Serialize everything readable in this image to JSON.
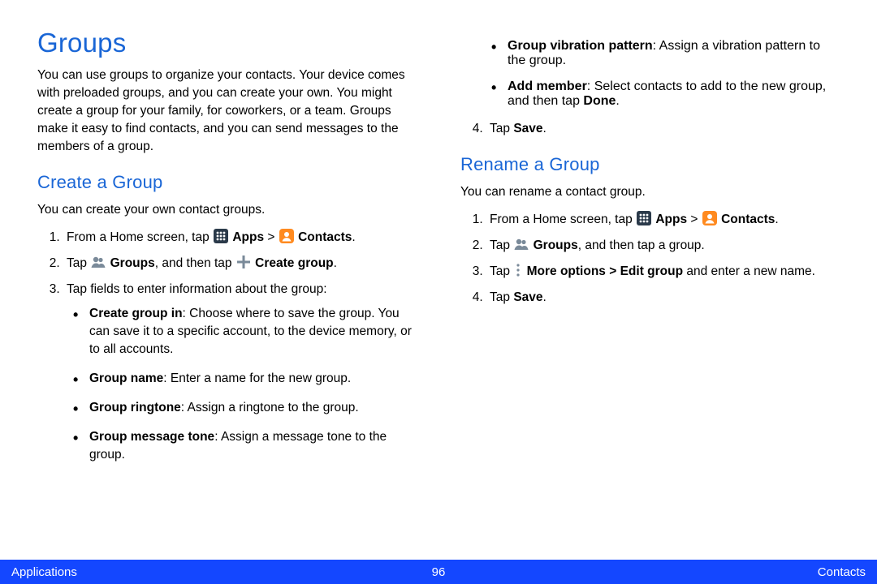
{
  "title": "Groups",
  "intro": "You can use groups to organize your contacts. Your device comes with preloaded groups, and you can create your own. You might create a group for your family, for coworkers, or a team. Groups make it easy to find contacts, and you can send messages to the members of a group.",
  "create": {
    "heading": "Create a Group",
    "sub": "You can create your own contact groups.",
    "step1_a": "From a Home screen, tap ",
    "step1_apps": "Apps",
    "step1_gt": " > ",
    "step1_contacts": "Contacts",
    "step1_end": ".",
    "step2_a": "Tap ",
    "step2_groups": "Groups",
    "step2_b": ", and then tap ",
    "step2_create": "Create group",
    "step2_end": ".",
    "step3": "Tap fields to enter information about the group:",
    "bullets": {
      "b1_label": "Create group in",
      "b1_text": ": Choose where to save the group. You can save it to a specific account, to the device memory, or to all accounts.",
      "b2_label": "Group name",
      "b2_text": ": Enter a name for the new group.",
      "b3_label": "Group ringtone",
      "b3_text": ": Assign a ringtone to the group.",
      "b4_label": "Group message tone",
      "b4_text": ": Assign a message tone to the group.",
      "b5_label": "Group vibration pattern",
      "b5_text": ": Assign a vibration pattern to the group.",
      "b6_label": "Add member",
      "b6_text": ": Select contacts to add to the new group, and then tap ",
      "b6_done": "Done",
      "b6_end": "."
    },
    "step4_a": "Tap ",
    "step4_save": "Save",
    "step4_end": "."
  },
  "rename": {
    "heading": "Rename a Group",
    "sub": "You can rename a contact group.",
    "step1_a": "From a Home screen, tap ",
    "step1_apps": "Apps",
    "step1_gt": " > ",
    "step1_contacts": "Contacts",
    "step1_end": ".",
    "step2_a": "Tap ",
    "step2_groups": "Groups",
    "step2_b": ", and then tap a group.",
    "step3_a": "Tap ",
    "step3_more": "More options > Edit group",
    "step3_b": " and enter a new name.",
    "step4_a": "Tap ",
    "step4_save": "Save",
    "step4_end": "."
  },
  "footer": {
    "left": "Applications",
    "center": "96",
    "right": "Contacts"
  }
}
